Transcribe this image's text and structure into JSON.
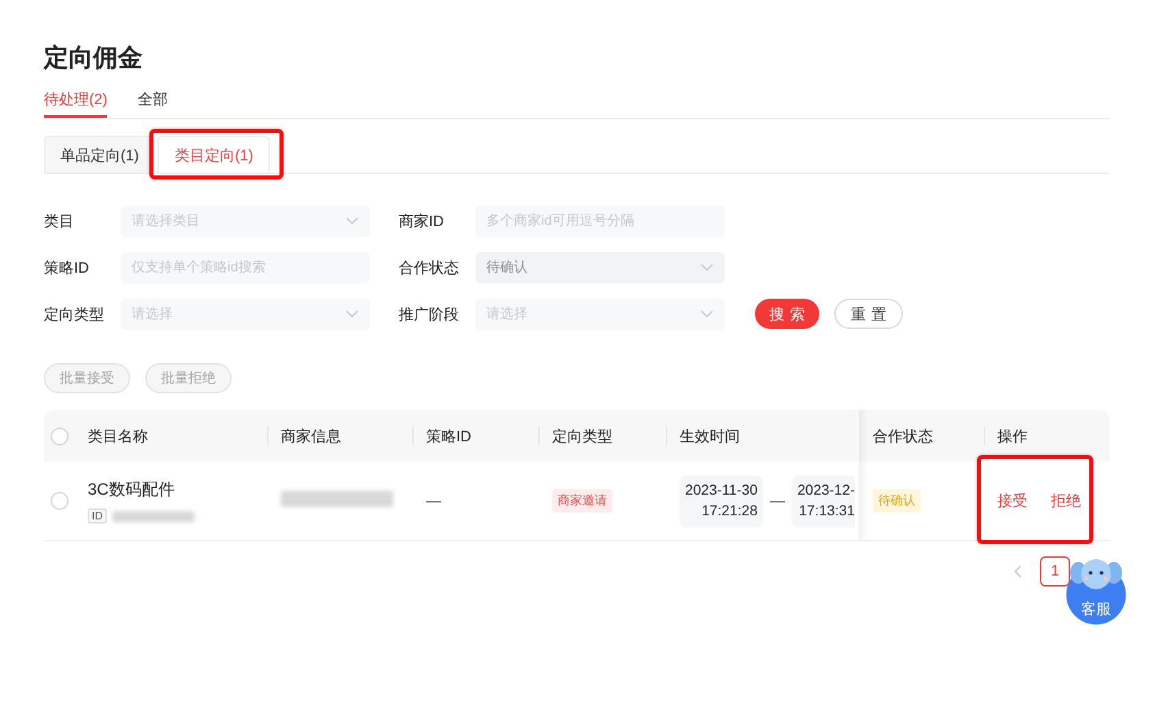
{
  "title": "定向佣金",
  "status_tabs": [
    {
      "label": "待处理(2)",
      "selected": true
    },
    {
      "label": "全部",
      "selected": false
    }
  ],
  "type_tabs": [
    {
      "label": "单品定向(1)",
      "selected": false,
      "highlighted": false
    },
    {
      "label": "类目定向(1)",
      "selected": true,
      "highlighted": true
    }
  ],
  "filters": [
    {
      "label": "类目",
      "kind": "select",
      "placeholder": "请选择类目"
    },
    {
      "label": "商家ID",
      "kind": "text",
      "placeholder": "多个商家id可用逗号分隔"
    },
    {
      "label": "策略ID",
      "kind": "text",
      "placeholder": "仅支持单个策略id搜索"
    },
    {
      "label": "合作状态",
      "kind": "select",
      "value": "待确认",
      "disabled": true
    },
    {
      "label": "定向类型",
      "kind": "select",
      "placeholder": "请选择"
    },
    {
      "label": "推广阶段",
      "kind": "select",
      "placeholder": "请选择"
    }
  ],
  "search_button": "搜索",
  "reset_button": "重置",
  "batch_buttons": [
    {
      "label": "批量接受",
      "disabled": true
    },
    {
      "label": "批量拒绝",
      "disabled": true
    }
  ],
  "table": {
    "all_selected": false,
    "columns": [
      "类目名称",
      "商家信息",
      "策略ID",
      "定向类型",
      "生效时间",
      "合作状态",
      "操作"
    ],
    "rows": [
      {
        "selected": false,
        "category": "3C数码配件",
        "id_label": "ID",
        "strategy_id": "—",
        "type_tag": "商家邀请",
        "start_date": "2023-11-30",
        "start_time": "17:21:28",
        "range_separator": "—",
        "end_date": "2023-12-",
        "end_time": "17:13:31",
        "status": "待确认",
        "actions": [
          "接受",
          "拒绝"
        ],
        "actions_highlighted": true
      }
    ]
  },
  "pagination": {
    "prev_disabled": true,
    "pages": [
      {
        "label": "1",
        "selected": true
      }
    ]
  },
  "service_button": "客服"
}
